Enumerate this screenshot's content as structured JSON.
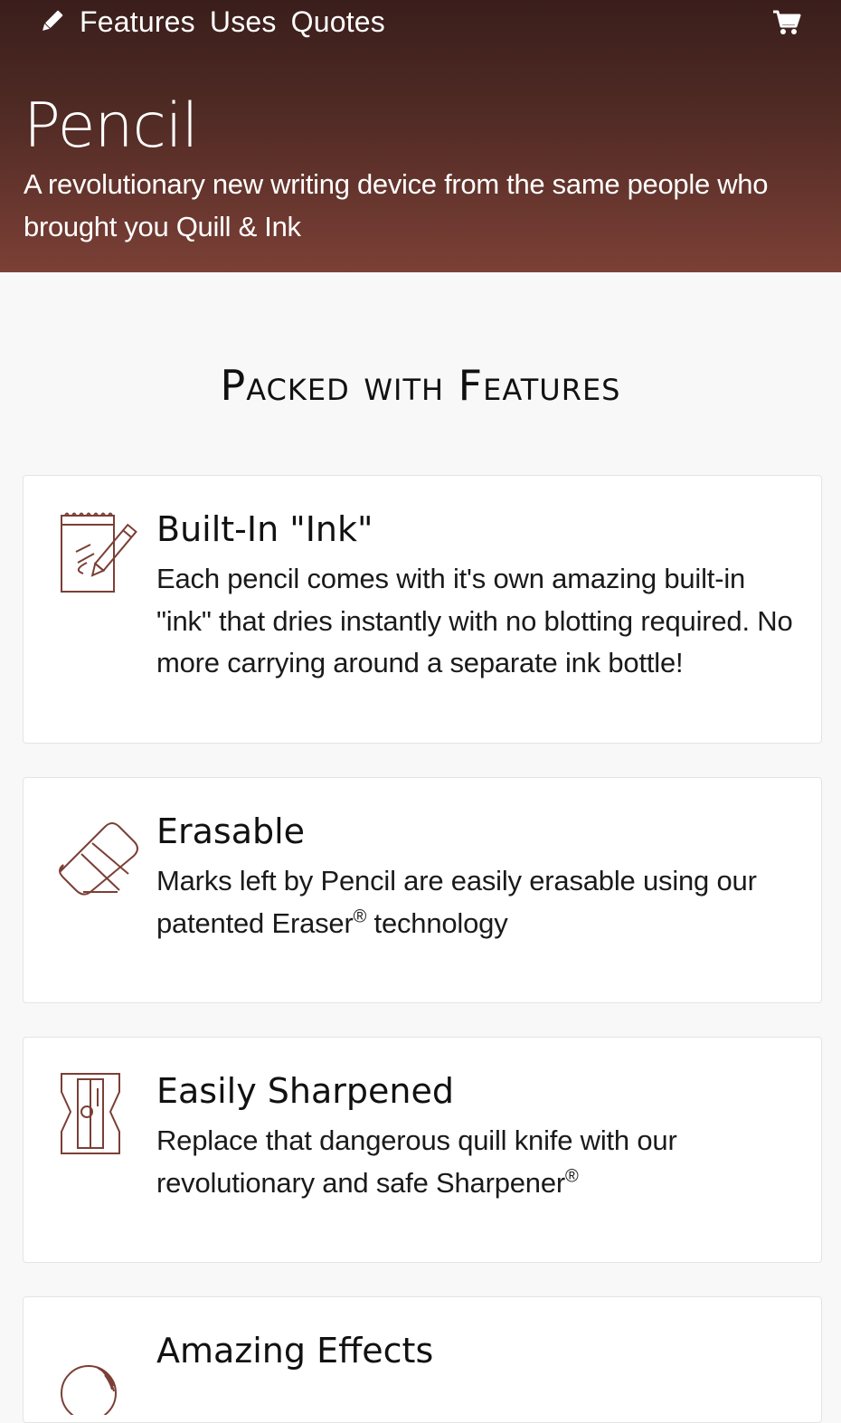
{
  "nav": {
    "links": [
      "Features",
      "Uses",
      "Quotes"
    ]
  },
  "hero": {
    "title": "Pencil",
    "subtitle": "A revolutionary new writing device from the same people who brought you Quill & Ink"
  },
  "features": {
    "section_title": "Packed with Features",
    "items": [
      {
        "title": "Built-In \"Ink\"",
        "body": "Each pencil comes with it's own amazing built-in \"ink\" that dries instantly with no blotting required. No more carrying around a separate ink bottle!",
        "icon": "notepad-pencil-icon"
      },
      {
        "title": "Erasable",
        "body_before": "Marks left by Pencil are easily erasable using our patented Eraser",
        "reg": "®",
        "body_after": " technology",
        "icon": "eraser-icon"
      },
      {
        "title": "Easily Sharpened",
        "body_before": "Replace that dangerous quill knife with our revolutionary and safe Sharpener",
        "reg": "®",
        "icon": "sharpener-icon"
      },
      {
        "title": "Amazing Effects",
        "icon": "sphere-icon"
      }
    ]
  },
  "colors": {
    "accent": "#7b3f36",
    "hero_top": "#3a1e1b",
    "hero_bottom": "#7b4036"
  }
}
